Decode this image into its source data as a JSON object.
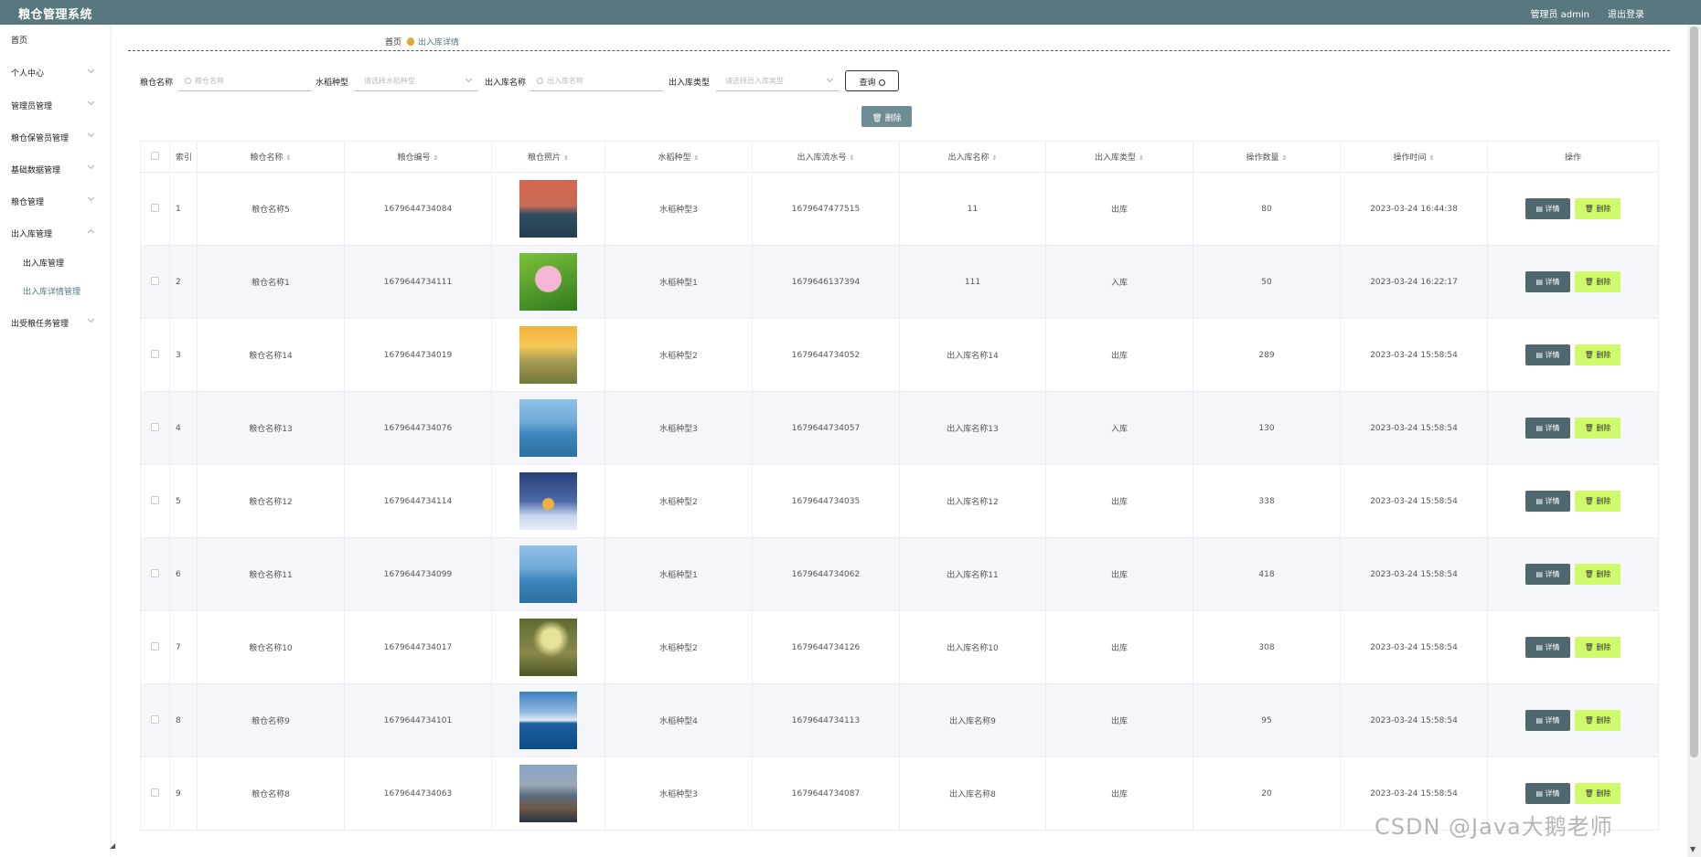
{
  "header": {
    "title": "粮仓管理系统",
    "user_label": "管理员 admin",
    "logout_label": "退出登录"
  },
  "sidebar": {
    "items": [
      {
        "label": "首页",
        "has_chevron": false
      },
      {
        "label": "个人中心",
        "has_chevron": true
      },
      {
        "label": "管理员管理",
        "has_chevron": true
      },
      {
        "label": "粮仓保管员管理",
        "has_chevron": true
      },
      {
        "label": "基础数据管理",
        "has_chevron": true
      },
      {
        "label": "粮仓管理",
        "has_chevron": true
      },
      {
        "label": "出入库管理",
        "has_chevron": true,
        "expanded": true
      },
      {
        "label": "出受粮任务管理",
        "has_chevron": true
      }
    ],
    "subitems": [
      {
        "label": "出入库管理"
      },
      {
        "label": "出入库详情管理",
        "active": true
      }
    ]
  },
  "breadcrumb": {
    "home": "首页",
    "current": "出入库详情"
  },
  "filters": {
    "name_label": "粮仓名称",
    "name_placeholder": "粮仓名称",
    "rice_label": "水稻种型",
    "rice_placeholder": "请选择水稻种型",
    "inout_name_label": "出入库名称",
    "inout_name_placeholder": "出入库名称",
    "inout_type_label": "出入库类型",
    "inout_type_placeholder": "请选择出入库类型",
    "query_label": "查询",
    "delete_label": "删除"
  },
  "table": {
    "headers": {
      "index": "索引",
      "name": "粮仓名称",
      "code": "粮仓编号",
      "photo": "粮仓照片",
      "rice": "水稻种型",
      "serial": "出入库流水号",
      "inout_name": "出入库名称",
      "inout_type": "出入库类型",
      "qty": "操作数量",
      "time": "操作时间",
      "ops": "操作"
    },
    "detail_label": "详情",
    "delete_label": "删除",
    "rows": [
      {
        "index": "1",
        "name": "粮仓名称5",
        "code": "1679644734084",
        "rice": "水稻种型3",
        "serial": "1679647477515",
        "inout_name": "11",
        "inout_type": "出库",
        "qty": "80",
        "time": "2023-03-24 16:44:38",
        "photo": "sunset-lake"
      },
      {
        "index": "2",
        "name": "粮仓名称1",
        "code": "1679644734111",
        "rice": "水稻种型1",
        "serial": "1679646137394",
        "inout_name": "111",
        "inout_type": "入库",
        "qty": "50",
        "time": "2023-03-24 16:22:17",
        "photo": "lotus"
      },
      {
        "index": "3",
        "name": "粮仓名称14",
        "code": "1679644734019",
        "rice": "水稻种型2",
        "serial": "1679644734052",
        "inout_name": "出入库名称14",
        "inout_type": "出库",
        "qty": "289",
        "time": "2023-03-24 15:58:54",
        "photo": "sunset-field"
      },
      {
        "index": "4",
        "name": "粮仓名称13",
        "code": "1679644734076",
        "rice": "水稻种型3",
        "serial": "1679644734057",
        "inout_name": "出入库名称13",
        "inout_type": "入库",
        "qty": "130",
        "time": "2023-03-24 15:58:54",
        "photo": "blue-lake"
      },
      {
        "index": "5",
        "name": "粮仓名称12",
        "code": "1679644734114",
        "rice": "水稻种型2",
        "serial": "1679644734035",
        "inout_name": "出入库名称12",
        "inout_type": "出库",
        "qty": "338",
        "time": "2023-03-24 15:58:54",
        "photo": "snow-cabin"
      },
      {
        "index": "6",
        "name": "粮仓名称11",
        "code": "1679644734099",
        "rice": "水稻种型1",
        "serial": "1679644734062",
        "inout_name": "出入库名称11",
        "inout_type": "出库",
        "qty": "418",
        "time": "2023-03-24 15:58:54",
        "photo": "blue-lake"
      },
      {
        "index": "7",
        "name": "粮仓名称10",
        "code": "1679644734017",
        "rice": "水稻种型2",
        "serial": "1679644734126",
        "inout_name": "出入库名称10",
        "inout_type": "出库",
        "qty": "308",
        "time": "2023-03-24 15:58:54",
        "photo": "forest-path"
      },
      {
        "index": "8",
        "name": "粮仓名称9",
        "code": "1679644734101",
        "rice": "水稻种型4",
        "serial": "1679644734113",
        "inout_name": "出入库名称9",
        "inout_type": "出库",
        "qty": "95",
        "time": "2023-03-24 15:58:54",
        "photo": "sea-sky"
      },
      {
        "index": "9",
        "name": "粮仓名称8",
        "code": "1679644734063",
        "rice": "水稻种型3",
        "serial": "1679644734087",
        "inout_name": "出入库名称8",
        "inout_type": "出库",
        "qty": "20",
        "time": "2023-03-24 15:58:54",
        "photo": "city-mountain"
      }
    ]
  },
  "watermark": "CSDN @Java大鹅老师",
  "colors": {
    "primary": "#58777f",
    "detail_button": "#4f6870",
    "delete_button": "#cffa6c",
    "row_alt": "#f4f6f9"
  }
}
